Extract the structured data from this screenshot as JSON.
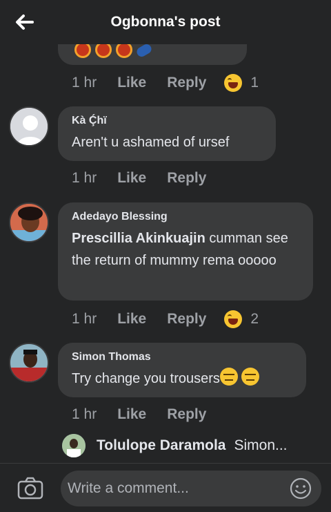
{
  "header": {
    "title": "Ogbonna's post"
  },
  "top_comment": {
    "time": "1 hr",
    "like": "Like",
    "reply": "Reply",
    "reaction_count": "1"
  },
  "comments": [
    {
      "author": "Kà Ḉhï",
      "text": "Aren't u ashamed of ursef",
      "time": "1 hr",
      "like": "Like",
      "reply": "Reply"
    },
    {
      "author": "Adedayo Blessing",
      "mention": "Prescillia Akinkuajin",
      "text": " cumman see the return of mummy rema ooooo",
      "time": "1 hr",
      "like": "Like",
      "reply": "Reply",
      "reaction_count": "2"
    },
    {
      "author": "Simon Thomas",
      "text": "Try change you trousers",
      "time": "1 hr",
      "like": "Like",
      "reply": "Reply"
    }
  ],
  "reply_preview": {
    "author": "Tolulope Daramola",
    "snippet": "Simon..."
  },
  "composer": {
    "placeholder": "Write a comment..."
  },
  "colors": {
    "background": "#242526",
    "bubble": "#3a3b3c",
    "text": "#e4e6eb",
    "muted": "#9ea1a6",
    "emoji": "#f7c531"
  },
  "icons": {
    "back": "back-arrow-icon",
    "camera": "camera-icon",
    "emoji": "smiley-icon"
  }
}
